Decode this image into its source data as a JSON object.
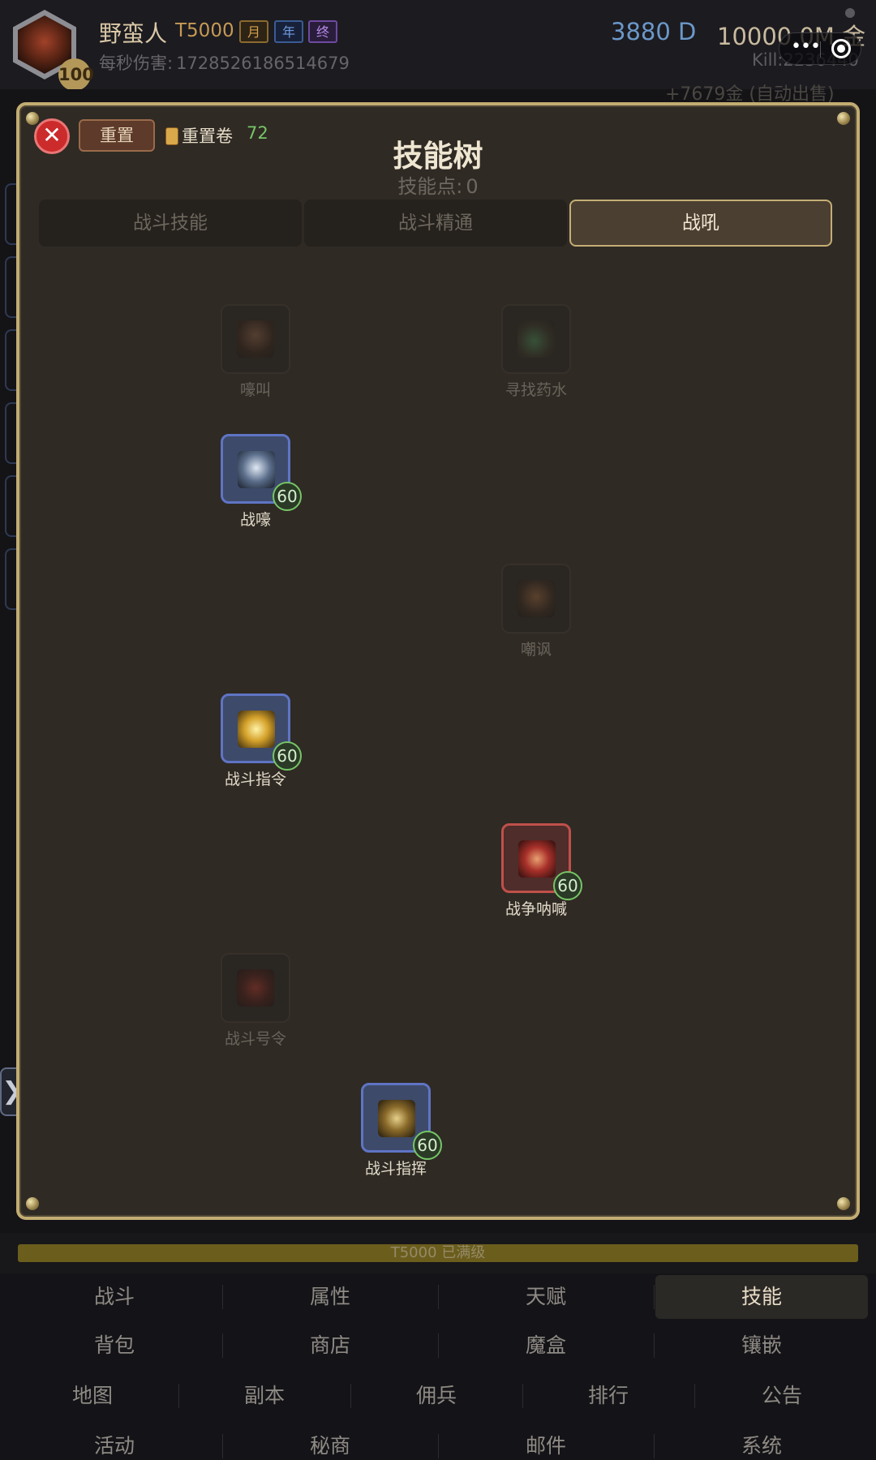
{
  "header": {
    "player_name": "野蛮人",
    "tier": "T5000",
    "level": "100",
    "tags": [
      "月",
      "年",
      "终"
    ],
    "dps_label": "每秒伤害:",
    "dps_value": "1728526186514679",
    "diamonds": "3880 D",
    "gold": "10000.0M 金",
    "kill": "Kill:2236440",
    "faded_line": "+7679金 (自动出售)"
  },
  "modal": {
    "reset_label": "重置",
    "reset_scroll_label": "重置卷",
    "reset_scroll_count": "72",
    "title": "技能树",
    "points_label": "技能点:",
    "points_value": "0",
    "tabs": [
      {
        "label": "战斗技能",
        "active": false
      },
      {
        "label": "战斗精通",
        "active": false
      },
      {
        "label": "战吼",
        "active": true
      }
    ],
    "skills": [
      {
        "name": "嚎叫",
        "state": "locked",
        "level": ""
      },
      {
        "name": "寻找药水",
        "state": "locked",
        "level": ""
      },
      {
        "name": "战嚎",
        "state": "learned",
        "level": "60"
      },
      {
        "name": "嘲讽",
        "state": "locked",
        "level": ""
      },
      {
        "name": "战斗指令",
        "state": "learned",
        "level": "60"
      },
      {
        "name": "战争呐喊",
        "state": "learned",
        "level": "60"
      },
      {
        "name": "战斗号令",
        "state": "locked",
        "level": ""
      },
      {
        "name": "战斗指挥",
        "state": "learned",
        "level": "60"
      }
    ]
  },
  "progress": {
    "text": "T5000 已满级",
    "fraction": 1.0
  },
  "nav": {
    "row1": [
      "战斗",
      "属性",
      "天赋",
      "技能"
    ],
    "row2": [
      "背包",
      "商店",
      "魔盒",
      "镶嵌"
    ],
    "row3": [
      "地图",
      "副本",
      "佣兵",
      "排行",
      "公告"
    ],
    "row4": [
      "活动",
      "秘商",
      "邮件",
      "系统"
    ],
    "active": "技能"
  },
  "icons": {
    "close": "close-icon",
    "scroll": "scroll-icon",
    "side_toggle": "chevron-right-icon",
    "more": "more-dots-icon",
    "target": "target-icon"
  },
  "colors": {
    "accent_gold": "#c2ac72",
    "level_badge": "#76c566",
    "learned_border": "#5f74c4",
    "learned_red_border": "#c0504a",
    "diamond": "#6b98c9"
  }
}
